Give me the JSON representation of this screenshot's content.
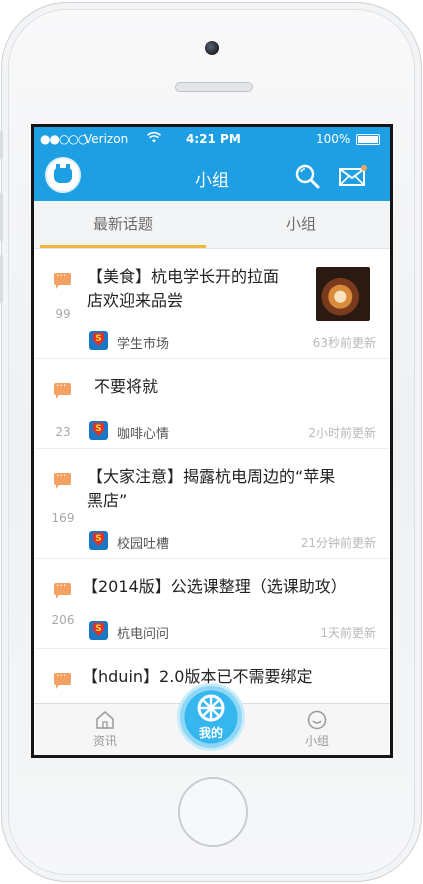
{
  "status_bar": {
    "signal": "●●○○○",
    "carrier": "Verizon",
    "time": "4:21 PM",
    "battery": "100%"
  },
  "nav": {
    "title": "小组"
  },
  "tabs": [
    {
      "label": "最新话题",
      "active": true
    },
    {
      "label": "小组",
      "active": false
    }
  ],
  "topics": [
    {
      "count": "99",
      "title_line1": "【美食】杭电学长开的拉面",
      "title_line2": "店欢迎来品尝",
      "group": "学生市场",
      "updated": "63秒前更新",
      "has_image": true
    },
    {
      "count": "23",
      "title_line1": "不要将就",
      "title_line2": "",
      "group": "咖啡心情",
      "updated": "2小时前更新",
      "has_image": false
    },
    {
      "count": "169",
      "title_line1": "【大家注意】揭露杭电周边的“苹果",
      "title_line2": "黑店”",
      "group": "校园吐槽",
      "updated": "21分钟前更新",
      "has_image": false
    },
    {
      "count": "206",
      "title_line1": "【2014版】公选课整理（选课助攻）",
      "title_line2": "",
      "group": "杭电问问",
      "updated": "1天前更新",
      "has_image": false
    },
    {
      "count": "",
      "title_line1": "【hduin】2.0版本已不需要绑定",
      "title_line2": "",
      "group": "",
      "updated": "",
      "has_image": false
    }
  ],
  "tabbar": {
    "news": "资讯",
    "mine": "我的",
    "group": "小组"
  },
  "colors": {
    "primary": "#1e9fe3",
    "tab_indicator": "#f2b43b",
    "comment_icon": "#f3a264"
  }
}
